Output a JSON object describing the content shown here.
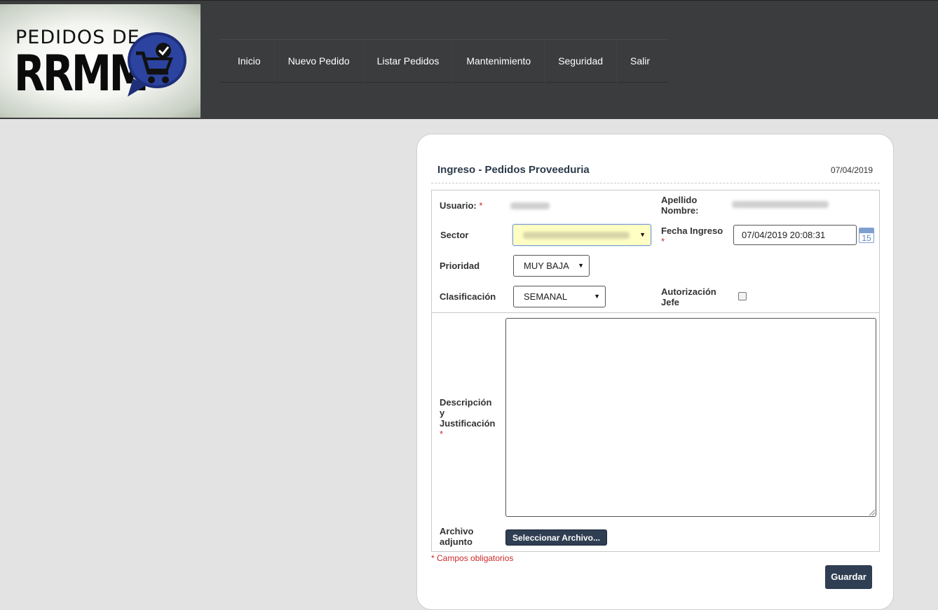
{
  "logo": {
    "line1": "PEDIDOS DE",
    "line2": "RRMM"
  },
  "nav": {
    "items": [
      "Inicio",
      "Nuevo Pedido",
      "Listar Pedidos",
      "Mantenimiento",
      "Seguridad",
      "Salir"
    ]
  },
  "form": {
    "title": "Ingreso - Pedidos Proveeduria",
    "date": "07/04/2019",
    "usuario_label": "Usuario:",
    "apellido_label": "Apellido",
    "nombre_label": "Nombre:",
    "sector_label": "Sector",
    "fecha_label": "Fecha Ingreso",
    "fecha_value": "07/04/2019 20:08:31",
    "calendar_day": "15",
    "prioridad_label": "Prioridad",
    "prioridad_value": "MUY BAJA",
    "clasificacion_label": "Clasificación",
    "clasificacion_value": "SEMANAL",
    "autorizacion_label1": "Autorización",
    "autorizacion_label2": "Jefe",
    "descripcion_label1": "Descripción",
    "descripcion_label2": "y",
    "descripcion_label3": "Justificación",
    "archivo_label1": "Archivo",
    "archivo_label2": "adjunto",
    "archivo_button": "Seleccionar Archivo...",
    "required_mark": "*",
    "required_note": "* Campos obligatorios",
    "save_button": "Guardar"
  }
}
